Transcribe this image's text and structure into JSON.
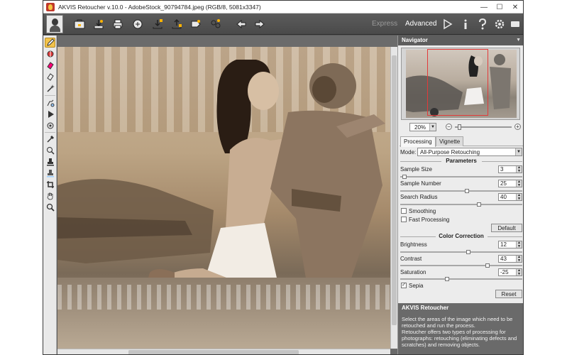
{
  "window": {
    "title": "AKVIS Retoucher v.10.0 - AdobeStock_90794784.jpeg (RGB/8, 5081x3347)",
    "controls": {
      "minimize": "—",
      "maximize": "☐",
      "close": "✕"
    }
  },
  "toolbar": {
    "buttons": [
      {
        "name": "portrait-icon"
      },
      {
        "name": "open-file-icon"
      },
      {
        "name": "save-file-icon"
      },
      {
        "name": "print-icon"
      },
      {
        "name": "share-icon"
      },
      {
        "name": "load-settings-icon"
      },
      {
        "name": "save-settings-icon"
      },
      {
        "name": "presets-icon"
      },
      {
        "name": "batch-icon"
      },
      {
        "name": "undo-icon"
      },
      {
        "name": "redo-icon"
      }
    ],
    "mode_express": "Express",
    "mode_advanced": "Advanced",
    "right_icons": [
      "run-icon",
      "info-icon",
      "help-icon",
      "settings-icon",
      "chat-icon"
    ]
  },
  "tools": [
    "selection-pencil-icon",
    "magic-tube-icon",
    "eraser-icon",
    "selection-eraser-icon",
    "magic-wand-icon",
    "clone-stamp-icon",
    "run-icon",
    "chameleon-brush-icon",
    "pipette-icon",
    "healing-brush-icon",
    "stamp-icon",
    "patch-icon",
    "crop-icon",
    "hand-icon",
    "zoom-icon"
  ],
  "navigator": {
    "title": "Navigator",
    "zoom": "20%"
  },
  "tabs": {
    "processing": "Processing",
    "vignette": "Vignette"
  },
  "settings": {
    "mode_label": "Mode:",
    "mode_value": "All-Purpose Retouching",
    "parameters_title": "Parameters",
    "sample_size_label": "Sample Size",
    "sample_size_value": "3",
    "sample_number_label": "Sample Number",
    "sample_number_value": "25",
    "search_radius_label": "Search Radius",
    "search_radius_value": "40",
    "smoothing_label": "Smoothing",
    "smoothing_checked": false,
    "fast_processing_label": "Fast Processing",
    "fast_processing_checked": false,
    "default_button": "Default",
    "color_correction_title": "Color Correction",
    "brightness_label": "Brightness",
    "brightness_value": "12",
    "contrast_label": "Contrast",
    "contrast_value": "43",
    "saturation_label": "Saturation",
    "saturation_value": "-25",
    "sepia_label": "Sepia",
    "sepia_checked": true,
    "reset_button": "Reset",
    "slider_levels": {
      "sample_size": 0.02,
      "sample_number": 0.55,
      "search_radius": 0.65,
      "brightness": 0.56,
      "contrast": 0.72,
      "saturation": 0.38
    }
  },
  "info": {
    "title": "AKVIS Retoucher",
    "text": "Select the areas of the image which need to be retouched and run the process.\nRetoucher offers two types of processing for photographs: retouching (eliminating defects and scratches) and removing objects."
  },
  "colors": {
    "toolbar_bg": "#4f4f4f",
    "active_tool": "#f3c34b",
    "panel_header": "#5d5d5d",
    "sepia_tone": "#b9a184",
    "nav_frame": "#e23a3a"
  }
}
